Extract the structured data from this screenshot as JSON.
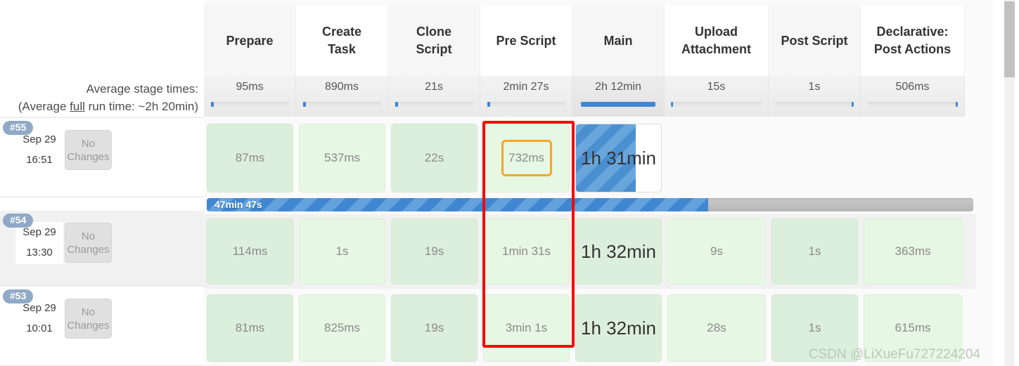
{
  "columns": [
    {
      "label": "Prepare",
      "avg": "95ms",
      "fill_pct": 3,
      "shade": "tint"
    },
    {
      "label": "Create\nTask",
      "avg": "890ms",
      "fill_pct": 3,
      "shade": "lite"
    },
    {
      "label": "Clone\nScript",
      "avg": "21s",
      "fill_pct": 3,
      "shade": "tint"
    },
    {
      "label": "Pre Script",
      "avg": "2min 27s",
      "fill_pct": 3,
      "shade": "lite"
    },
    {
      "label": "Main",
      "avg": "2h 12min",
      "fill_pct": 96,
      "shade": "tint"
    },
    {
      "label": "Upload\nAttachment",
      "avg": "15s",
      "fill_pct": 2,
      "shade": "lite"
    },
    {
      "label": "Post Script",
      "avg": "1s",
      "fill_pct": 2,
      "shade": "tint"
    },
    {
      "label": "Declarative:\nPost Actions",
      "avg": "506ms",
      "fill_pct": 2,
      "shade": "lite"
    }
  ],
  "header": {
    "col1": "Prepare",
    "col2_line1": "Create",
    "col2_line2": "Task",
    "col3_line1": "Clone",
    "col3_line2": "Script",
    "col4": "Pre Script",
    "col5": "Main",
    "col6_line1": "Upload",
    "col6_line2": "Attachment",
    "col7": "Post Script",
    "col8_line1": "Declarative:",
    "col8_line2": "Post Actions"
  },
  "average_row": {
    "label_line1": "Average stage times:",
    "label_line2_pre": "(Average ",
    "label_line2_u": "full",
    "label_line2_post": " run time: ~2h 20min)",
    "times": {
      "prepare": "95ms",
      "create_task": "890ms",
      "clone_script": "21s",
      "pre_script": "2min 27s",
      "main": "2h 12min",
      "upload_attachment": "15s",
      "post_script": "1s",
      "declarative_post_actions": "506ms"
    }
  },
  "runs": [
    {
      "id": "#55",
      "date": "Sep 29",
      "time": "16:51",
      "changes_line1": "No",
      "changes_line2": "Changes",
      "cells": {
        "prepare": "87ms",
        "create_task": "537ms",
        "clone_script": "22s",
        "pre_script": "732ms",
        "main": "1h 31min",
        "upload_attachment": "",
        "post_script": "",
        "declarative_post_actions": ""
      },
      "progress": {
        "label": "47min 47s",
        "pct": 65.4
      }
    },
    {
      "id": "#54",
      "date": "Sep 29",
      "time": "13:30",
      "changes_line1": "No",
      "changes_line2": "Changes",
      "cells": {
        "prepare": "114ms",
        "create_task": "1s",
        "clone_script": "19s",
        "pre_script": "1min 31s",
        "main": "1h 32min",
        "upload_attachment": "9s",
        "post_script": "1s",
        "declarative_post_actions": "363ms"
      }
    },
    {
      "id": "#53",
      "date": "Sep 29",
      "time": "10:01",
      "changes_line1": "No",
      "changes_line2": "Changes",
      "cells": {
        "prepare": "81ms",
        "create_task": "825ms",
        "clone_script": "19s",
        "pre_script": "3min 1s",
        "main": "1h 32min",
        "upload_attachment": "28s",
        "post_script": "1s",
        "declarative_post_actions": "615ms"
      }
    }
  ],
  "annotations": {
    "red_highlight_column": "Pre Script",
    "orange_highlight_value": "732ms"
  },
  "watermark": "CSDN @LiXueFu727224204",
  "colors": {
    "accent_blue": "#3f87d1",
    "badge_blue": "#8fa9c6",
    "cell_green": "#dcefdc",
    "cell_green_light": "#e6f7e3",
    "highlight_red": "#fb0505",
    "highlight_orange": "#f5a623"
  }
}
